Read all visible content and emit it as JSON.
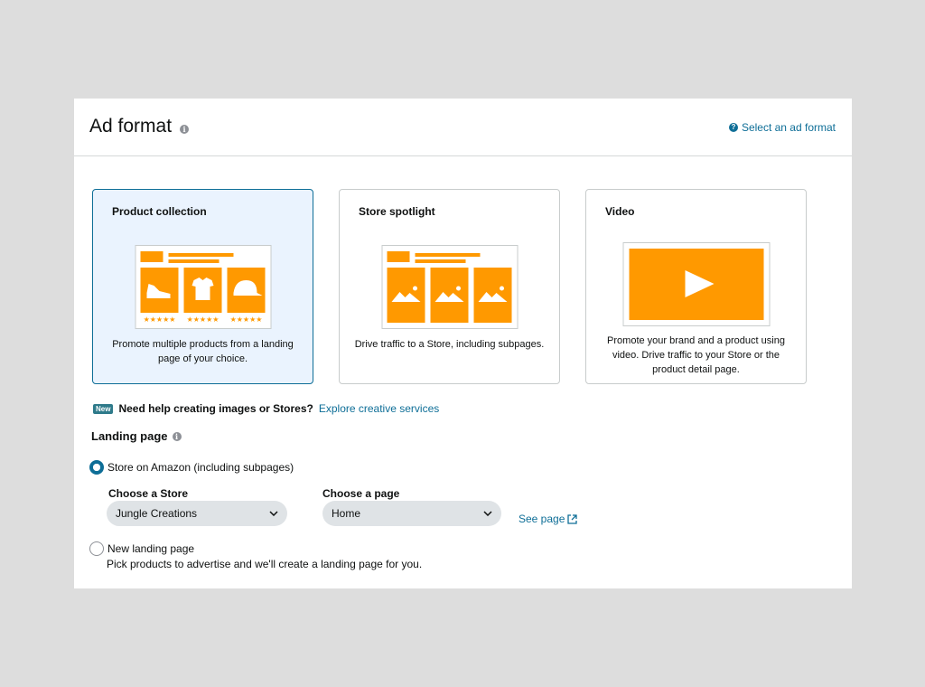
{
  "header": {
    "title": "Ad format",
    "help_link": "Select an ad format"
  },
  "cards": [
    {
      "title": "Product collection",
      "description": "Promote multiple products from a landing page of your choice.",
      "selected": true
    },
    {
      "title": "Store spotlight",
      "description": "Drive traffic to a Store, including subpages.",
      "selected": false
    },
    {
      "title": "Video",
      "description": "Promote your brand and a product using video. Drive traffic to your Store or the product detail page.",
      "selected": false
    }
  ],
  "help_banner": {
    "badge": "New",
    "text": "Need help creating images or Stores?",
    "link": "Explore creative services"
  },
  "landing_page": {
    "label": "Landing page",
    "option_store": "Store on Amazon (including subpages)",
    "store_field_label": "Choose a Store",
    "store_value": "Jungle Creations",
    "page_field_label": "Choose a page",
    "page_value": "Home",
    "see_page": "See page",
    "option_new": "New landing page",
    "option_new_desc": "Pick products to advertise and we'll create a landing page for you.",
    "selected_option": "store"
  },
  "colors": {
    "accent": "#0e6e97",
    "thumb_orange": "#ff9900",
    "selected_bg": "#eaf3fe"
  }
}
